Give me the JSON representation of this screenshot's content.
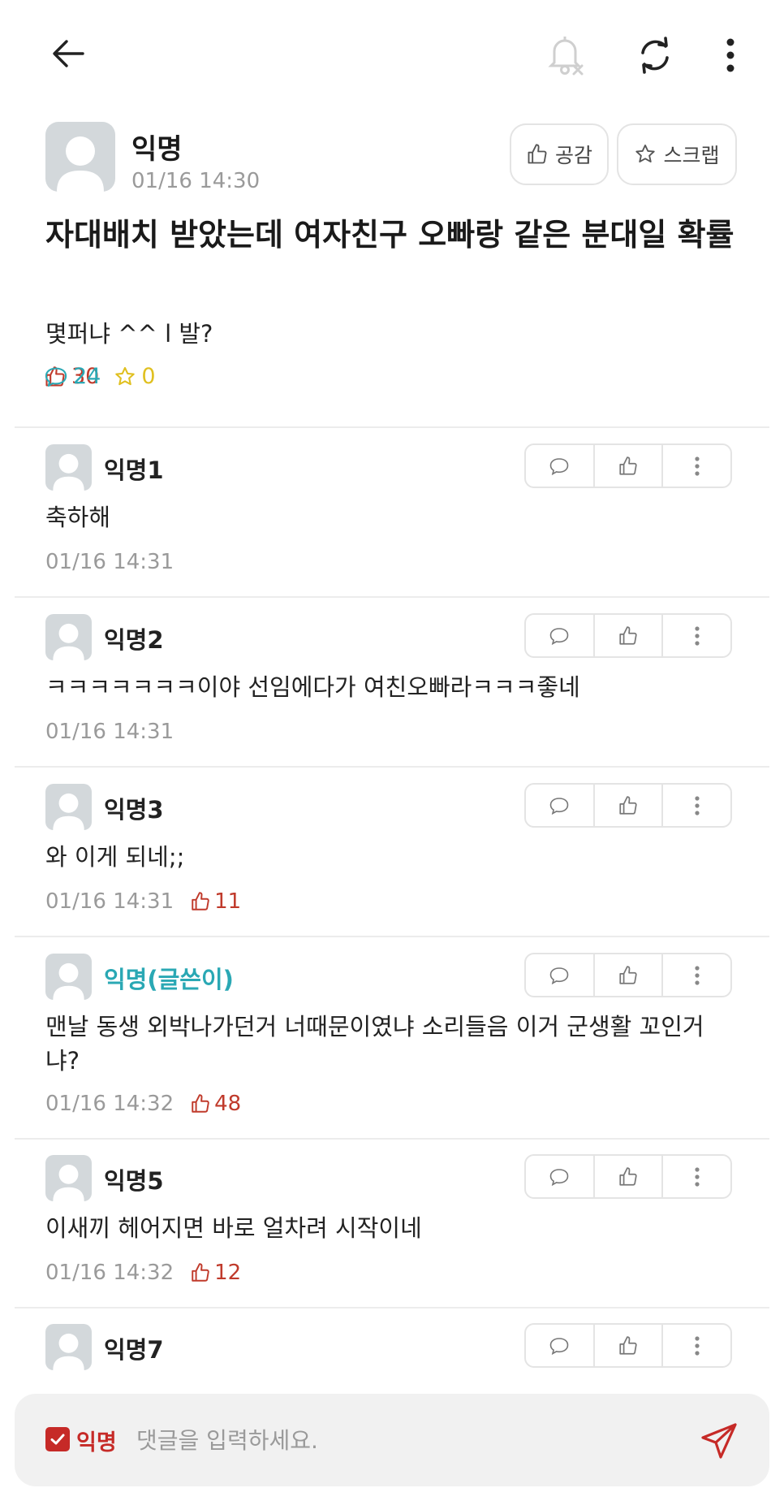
{
  "icons": {
    "back": "arrow-left-icon",
    "notification_off": "bell-off-icon",
    "refresh": "refresh-icon",
    "more": "more-vertical-icon",
    "like": "thumbs-up-icon",
    "comment": "speech-bubble-icon",
    "scrap": "star-icon",
    "send": "paper-plane-icon"
  },
  "colors": {
    "like": "#c03a2b",
    "comment": "#2aa8b4",
    "scrap": "#e0c020",
    "op_name": "#2aa8b4",
    "anon_check": "#c62a27"
  },
  "post": {
    "author": "익명",
    "time": "01/16 14:30",
    "like_button_label": "공감",
    "scrap_button_label": "스크랩",
    "title": "자대배치 받았는데 여자친구 오빠랑 같은 분대일 확률",
    "body": "몇퍼냐 ^^ l 발?",
    "stats": {
      "likes": "30",
      "comments": "24",
      "scraps": "0"
    }
  },
  "comments": [
    {
      "name": "익명1",
      "text": "축하해",
      "time": "01/16 14:31",
      "likes": ""
    },
    {
      "name": "익명2",
      "text": "ㅋㅋㅋㅋㅋㅋㅋ이야 선임에다가 여친오빠라ㅋㅋㅋ좋네",
      "time": "01/16 14:31",
      "likes": ""
    },
    {
      "name": "익명3",
      "text": "와 이게 되네;;",
      "time": "01/16 14:31",
      "likes": "11"
    },
    {
      "name": "익명(글쓴이)",
      "text": "맨날 동생 외박나가던거 너때문이였냐 소리들음 이거 군생활 꼬인거냐?",
      "time": "01/16 14:32",
      "likes": "48"
    },
    {
      "name": "익명5",
      "text": "이새끼 헤어지면 바로 얼차려 시작이네",
      "time": "01/16 14:32",
      "likes": "12"
    },
    {
      "name": "익명7",
      "text": "",
      "time": "",
      "likes": ""
    }
  ],
  "composer": {
    "anonymous_label": "익명",
    "anonymous_checked": true,
    "placeholder": "댓글을 입력하세요."
  }
}
